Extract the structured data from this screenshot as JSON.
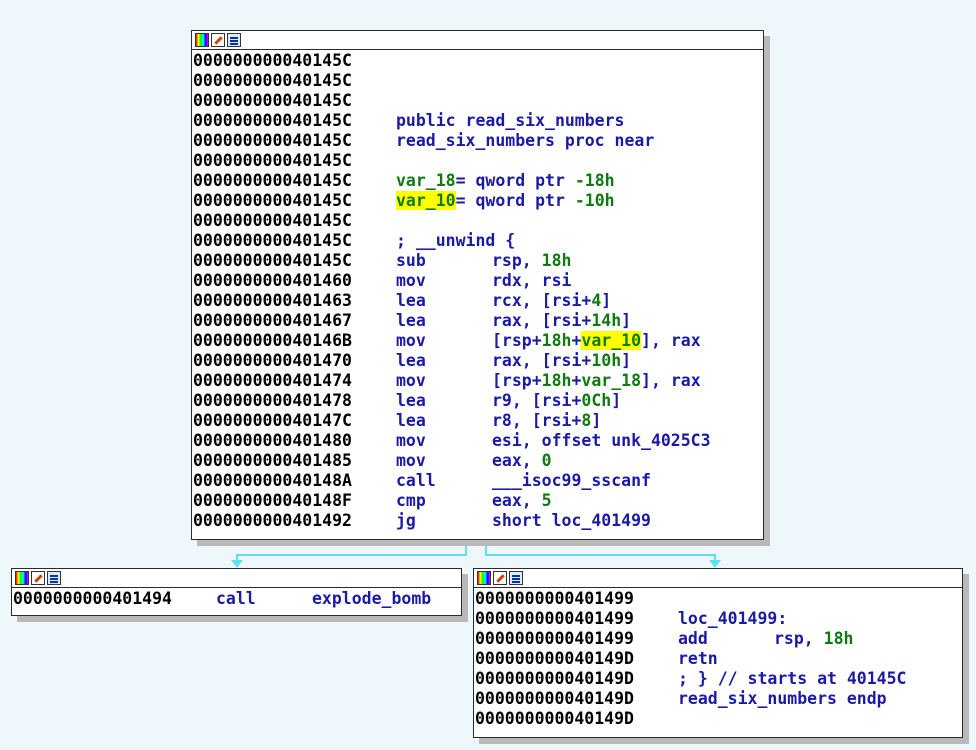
{
  "top_block": {
    "lines": [
      {
        "addr": "000000000040145C"
      },
      {
        "addr": "000000000040145C"
      },
      {
        "addr": "000000000040145C"
      },
      {
        "addr": "000000000040145C",
        "text": "public read_six_numbers"
      },
      {
        "addr": "000000000040145C",
        "text": "read_six_numbers proc near"
      },
      {
        "addr": "000000000040145C"
      },
      {
        "addr": "000000000040145C",
        "var": "var_18",
        "rest": "= qword ptr ",
        "val": "-18h",
        "highlight": false
      },
      {
        "addr": "000000000040145C",
        "var": "var_10",
        "rest": "= qword ptr ",
        "val": "-10h",
        "highlight": true
      },
      {
        "addr": "000000000040145C"
      },
      {
        "addr": "000000000040145C",
        "comment": "; __unwind {"
      },
      {
        "addr": "000000000040145C",
        "mnem": "sub",
        "ops": [
          {
            "t": "rsp, "
          },
          {
            "n": "18h"
          }
        ]
      },
      {
        "addr": "0000000000401460",
        "mnem": "mov",
        "ops": [
          {
            "t": "rdx, rsi"
          }
        ]
      },
      {
        "addr": "0000000000401463",
        "mnem": "lea",
        "ops": [
          {
            "t": "rcx, [rsi+"
          },
          {
            "n": "4"
          },
          {
            "t": "]"
          }
        ]
      },
      {
        "addr": "0000000000401467",
        "mnem": "lea",
        "ops": [
          {
            "t": "rax, [rsi+"
          },
          {
            "n": "14h"
          },
          {
            "t": "]"
          }
        ]
      },
      {
        "addr": "000000000040146B",
        "mnem": "mov",
        "ops": [
          {
            "t": "[rsp+"
          },
          {
            "n": "18h"
          },
          {
            "t": "+"
          },
          {
            "h": "var_10"
          },
          {
            "t": "], rax"
          }
        ]
      },
      {
        "addr": "0000000000401470",
        "mnem": "lea",
        "ops": [
          {
            "t": "rax, [rsi+"
          },
          {
            "n": "10h"
          },
          {
            "t": "]"
          }
        ]
      },
      {
        "addr": "0000000000401474",
        "mnem": "mov",
        "ops": [
          {
            "t": "[rsp+"
          },
          {
            "n": "18h"
          },
          {
            "t": "+"
          },
          {
            "v": "var_18"
          },
          {
            "t": "], rax"
          }
        ]
      },
      {
        "addr": "0000000000401478",
        "mnem": "lea",
        "ops": [
          {
            "t": "r9, [rsi+"
          },
          {
            "n": "0Ch"
          },
          {
            "t": "]"
          }
        ]
      },
      {
        "addr": "000000000040147C",
        "mnem": "lea",
        "ops": [
          {
            "t": "r8, [rsi+"
          },
          {
            "n": "8"
          },
          {
            "t": "]"
          }
        ]
      },
      {
        "addr": "0000000000401480",
        "mnem": "mov",
        "ops": [
          {
            "t": "esi, offset unk_4025C3"
          }
        ]
      },
      {
        "addr": "0000000000401485",
        "mnem": "mov",
        "ops": [
          {
            "t": "eax, "
          },
          {
            "n": "0"
          }
        ]
      },
      {
        "addr": "000000000040148A",
        "mnem": "call",
        "ops": [
          {
            "t": "___isoc99_sscanf"
          }
        ]
      },
      {
        "addr": "000000000040148F",
        "mnem": "cmp",
        "ops": [
          {
            "t": "eax, "
          },
          {
            "n": "5"
          }
        ]
      },
      {
        "addr": "0000000000401492",
        "mnem": "jg",
        "ops": [
          {
            "t": "short loc_401499"
          }
        ]
      }
    ]
  },
  "left_block": {
    "lines": [
      {
        "addr": "0000000000401494",
        "mnem": "call",
        "ops": [
          {
            "t": "explode_bomb"
          }
        ]
      }
    ]
  },
  "right_block": {
    "lines": [
      {
        "addr": "0000000000401499"
      },
      {
        "addr": "0000000000401499",
        "text": "loc_401499:"
      },
      {
        "addr": "0000000000401499",
        "mnem": "add",
        "ops": [
          {
            "t": "rsp, "
          },
          {
            "n": "18h"
          }
        ]
      },
      {
        "addr": "000000000040149D",
        "mnem": "retn",
        "ops": []
      },
      {
        "addr": "000000000040149D",
        "comment": "; } // starts at 40145C"
      },
      {
        "addr": "000000000040149D",
        "text": "read_six_numbers endp"
      },
      {
        "addr": "000000000040149D"
      }
    ]
  },
  "colors": {
    "background": "#eef7fc",
    "address": "#000000",
    "instruction": "#1a1aa6",
    "number": "#107a10",
    "highlight": "#ffff00",
    "edge": "#5ee0ef"
  },
  "icons": [
    "graph-overview-icon",
    "edit-color-icon",
    "xrefs-icon"
  ]
}
